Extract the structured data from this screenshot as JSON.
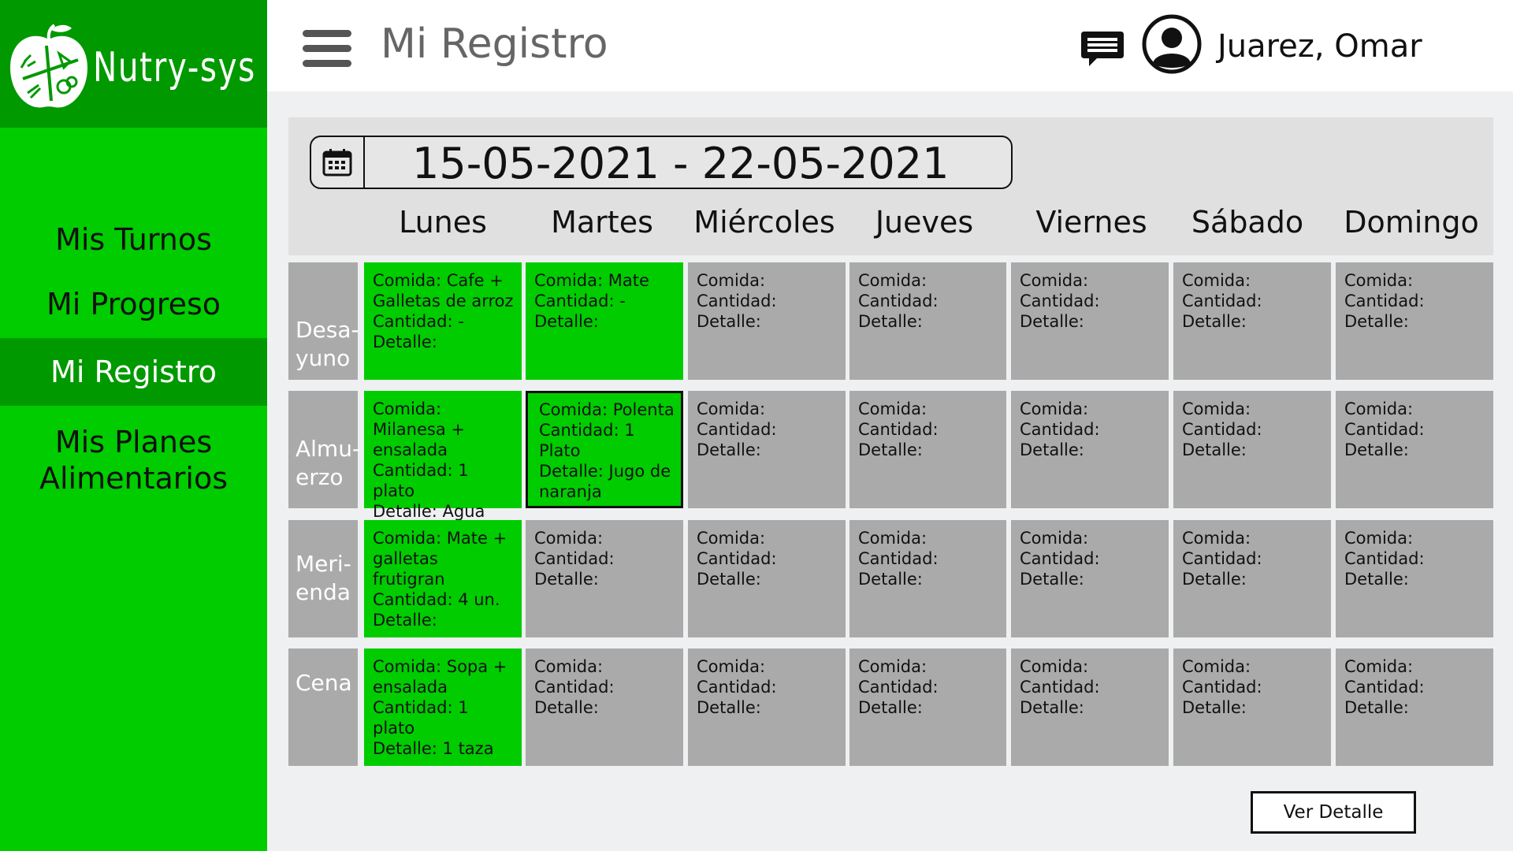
{
  "app": {
    "name": "Nutry-sys"
  },
  "sidebar": {
    "items": [
      {
        "label": "Mis Turnos"
      },
      {
        "label": "Mi Progreso"
      },
      {
        "label": "Mi Registro",
        "active": true
      },
      {
        "label_line1": "Mis Planes",
        "label_line2": "Alimentarios"
      }
    ]
  },
  "header": {
    "title": "Mi Registro",
    "user_name": "Juarez, Omar",
    "icons": [
      "menu-icon",
      "chat-icon",
      "user-avatar-icon"
    ]
  },
  "registro": {
    "date_range": "15-05-2021 - 22-05-2021",
    "days": [
      "Lunes",
      "Martes",
      "Miércoles",
      "Jueves",
      "Viernes",
      "Sábado",
      "Domingo"
    ],
    "meals": [
      {
        "label_line1": "Desa-",
        "label_line2": "yuno"
      },
      {
        "label_line1": "Almu-",
        "label_line2": "erzo"
      },
      {
        "label_line1": "Meri-",
        "label_line2": "enda"
      },
      {
        "label_line1": "Cena",
        "label_line2": ""
      }
    ],
    "cells": [
      [
        {
          "lines": [
            "Comida: Cafe +",
            "Galletas de arroz",
            "Cantidad: -",
            "Detalle:"
          ],
          "filled": true
        },
        {
          "lines": [
            "Comida: Mate",
            "Cantidad: -",
            "Detalle:"
          ],
          "filled": true
        },
        {
          "lines": [
            "Comida:",
            "Cantidad:",
            "Detalle:"
          ]
        },
        {
          "lines": [
            "Comida:",
            "Cantidad:",
            "Detalle:"
          ]
        },
        {
          "lines": [
            "Comida:",
            "Cantidad:",
            "Detalle:"
          ]
        },
        {
          "lines": [
            "Comida:",
            "Cantidad:",
            "Detalle:"
          ]
        },
        {
          "lines": [
            "Comida:",
            "Cantidad:",
            "Detalle:"
          ]
        }
      ],
      [
        {
          "lines": [
            "Comida: Milanesa +",
            "ensalada",
            "Cantidad: 1 plato",
            "Detalle: Agua"
          ],
          "filled": true
        },
        {
          "lines": [
            "Comida: Polenta",
            "Cantidad: 1 Plato",
            "Detalle: Jugo de",
            "naranja"
          ],
          "filled": true,
          "selected": true
        },
        {
          "lines": [
            "Comida:",
            "Cantidad:",
            "Detalle:"
          ]
        },
        {
          "lines": [
            "Comida:",
            "Cantidad:",
            "Detalle:"
          ]
        },
        {
          "lines": [
            "Comida:",
            "Cantidad:",
            "Detalle:"
          ]
        },
        {
          "lines": [
            "Comida:",
            "Cantidad:",
            "Detalle:"
          ]
        },
        {
          "lines": [
            "Comida:",
            "Cantidad:",
            "Detalle:"
          ]
        }
      ],
      [
        {
          "lines": [
            "Comida: Mate +",
            "galletas frutigran",
            "Cantidad: 4 un.",
            "Detalle:"
          ],
          "filled": true
        },
        {
          "lines": [
            "Comida:",
            "Cantidad:",
            "Detalle:"
          ]
        },
        {
          "lines": [
            "Comida:",
            "Cantidad:",
            "Detalle:"
          ]
        },
        {
          "lines": [
            "Comida:",
            "Cantidad:",
            "Detalle:"
          ]
        },
        {
          "lines": [
            "Comida:",
            "Cantidad:",
            "Detalle:"
          ]
        },
        {
          "lines": [
            "Comida:",
            "Cantidad:",
            "Detalle:"
          ]
        },
        {
          "lines": [
            "Comida:",
            "Cantidad:",
            "Detalle:"
          ]
        }
      ],
      [
        {
          "lines": [
            "Comida: Sopa +",
            "ensalada",
            "Cantidad: 1 plato",
            "Detalle: 1 taza"
          ],
          "filled": true
        },
        {
          "lines": [
            "Comida:",
            "Cantidad:",
            "Detalle:"
          ]
        },
        {
          "lines": [
            "Comida:",
            "Cantidad:",
            "Detalle:"
          ]
        },
        {
          "lines": [
            "Comida:",
            "Cantidad:",
            "Detalle:"
          ]
        },
        {
          "lines": [
            "Comida:",
            "Cantidad:",
            "Detalle:"
          ]
        },
        {
          "lines": [
            "Comida:",
            "Cantidad:",
            "Detalle:"
          ]
        },
        {
          "lines": [
            "Comida:",
            "Cantidad:",
            "Detalle:"
          ]
        }
      ]
    ],
    "detail_button": "Ver Detalle"
  },
  "colors": {
    "sidebar": "#00cc00",
    "sidebar_active": "#009900",
    "cell_filled": "#00cc00",
    "cell_empty": "#aaaaaa",
    "main_bg": "#eff0f1"
  }
}
